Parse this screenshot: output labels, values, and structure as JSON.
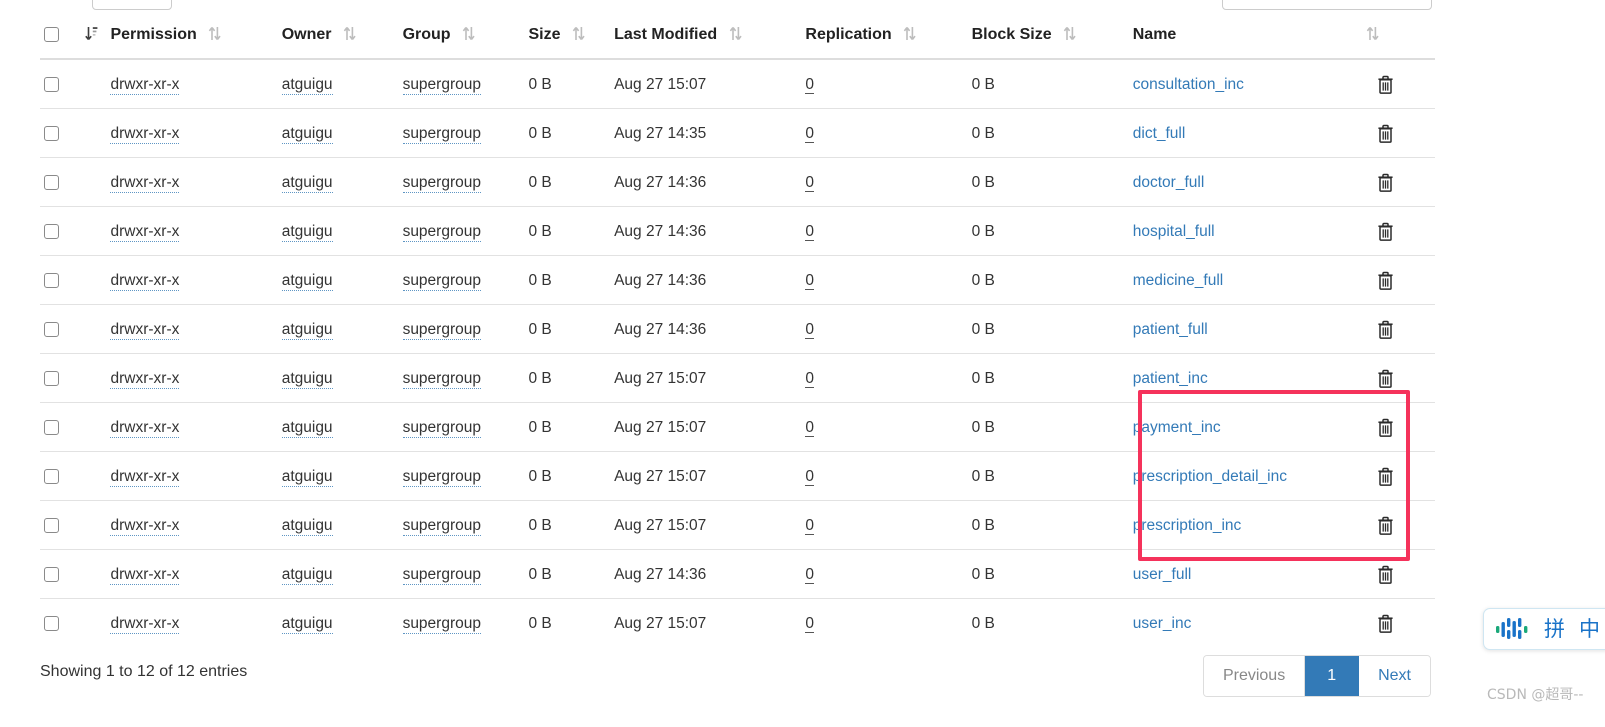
{
  "controls": {
    "page_length_value": "",
    "search_value": "",
    "search_placeholder": ""
  },
  "table": {
    "columns": [
      {
        "key": "select",
        "label": "",
        "sort": "none"
      },
      {
        "key": "sort_primary",
        "label": "",
        "sort": "desc"
      },
      {
        "key": "permission",
        "label": "Permission",
        "sort": "both"
      },
      {
        "key": "owner",
        "label": "Owner",
        "sort": "both"
      },
      {
        "key": "group",
        "label": "Group",
        "sort": "both"
      },
      {
        "key": "size",
        "label": "Size",
        "sort": "both"
      },
      {
        "key": "last_modified",
        "label": "Last Modified",
        "sort": "both"
      },
      {
        "key": "replication",
        "label": "Replication",
        "sort": "both"
      },
      {
        "key": "block_size",
        "label": "Block Size",
        "sort": "both"
      },
      {
        "key": "name",
        "label": "Name",
        "sort": "both"
      },
      {
        "key": "actions",
        "label": "",
        "sort": "none"
      }
    ],
    "rows": [
      {
        "permission": "drwxr-xr-x",
        "owner": "atguigu",
        "group": "supergroup",
        "size": "0 B",
        "last_modified": "Aug 27 15:07",
        "replication": "0",
        "block_size": "0 B",
        "name": "consultation_inc"
      },
      {
        "permission": "drwxr-xr-x",
        "owner": "atguigu",
        "group": "supergroup",
        "size": "0 B",
        "last_modified": "Aug 27 14:35",
        "replication": "0",
        "block_size": "0 B",
        "name": "dict_full"
      },
      {
        "permission": "drwxr-xr-x",
        "owner": "atguigu",
        "group": "supergroup",
        "size": "0 B",
        "last_modified": "Aug 27 14:36",
        "replication": "0",
        "block_size": "0 B",
        "name": "doctor_full"
      },
      {
        "permission": "drwxr-xr-x",
        "owner": "atguigu",
        "group": "supergroup",
        "size": "0 B",
        "last_modified": "Aug 27 14:36",
        "replication": "0",
        "block_size": "0 B",
        "name": "hospital_full"
      },
      {
        "permission": "drwxr-xr-x",
        "owner": "atguigu",
        "group": "supergroup",
        "size": "0 B",
        "last_modified": "Aug 27 14:36",
        "replication": "0",
        "block_size": "0 B",
        "name": "medicine_full"
      },
      {
        "permission": "drwxr-xr-x",
        "owner": "atguigu",
        "group": "supergroup",
        "size": "0 B",
        "last_modified": "Aug 27 14:36",
        "replication": "0",
        "block_size": "0 B",
        "name": "patient_full"
      },
      {
        "permission": "drwxr-xr-x",
        "owner": "atguigu",
        "group": "supergroup",
        "size": "0 B",
        "last_modified": "Aug 27 15:07",
        "replication": "0",
        "block_size": "0 B",
        "name": "patient_inc"
      },
      {
        "permission": "drwxr-xr-x",
        "owner": "atguigu",
        "group": "supergroup",
        "size": "0 B",
        "last_modified": "Aug 27 15:07",
        "replication": "0",
        "block_size": "0 B",
        "name": "payment_inc"
      },
      {
        "permission": "drwxr-xr-x",
        "owner": "atguigu",
        "group": "supergroup",
        "size": "0 B",
        "last_modified": "Aug 27 15:07",
        "replication": "0",
        "block_size": "0 B",
        "name": "prescription_detail_inc"
      },
      {
        "permission": "drwxr-xr-x",
        "owner": "atguigu",
        "group": "supergroup",
        "size": "0 B",
        "last_modified": "Aug 27 15:07",
        "replication": "0",
        "block_size": "0 B",
        "name": "prescription_inc"
      },
      {
        "permission": "drwxr-xr-x",
        "owner": "atguigu",
        "group": "supergroup",
        "size": "0 B",
        "last_modified": "Aug 27 14:36",
        "replication": "0",
        "block_size": "0 B",
        "name": "user_full"
      },
      {
        "permission": "drwxr-xr-x",
        "owner": "atguigu",
        "group": "supergroup",
        "size": "0 B",
        "last_modified": "Aug 27 15:07",
        "replication": "0",
        "block_size": "0 B",
        "name": "user_inc"
      }
    ]
  },
  "footer": {
    "showing": "Showing 1 to 12 of 12 entries",
    "pagination": {
      "previous_label": "Previous",
      "pages": [
        "1"
      ],
      "next_label": "Next",
      "active_page": "1"
    }
  },
  "annotation": {
    "highlight_color": "#f5325b",
    "highlighted_names": [
      "patient_inc",
      "payment_inc",
      "prescription_detail_inc",
      "prescription_inc"
    ]
  },
  "ime": {
    "method_label": "拼",
    "language_label": "中"
  },
  "watermark": {
    "text": "CSDN @超哥--"
  },
  "colors": {
    "link": "#337ab7",
    "active_page_bg": "#337ab7",
    "highlight": "#f5325b",
    "border": "#e2e2e2"
  }
}
